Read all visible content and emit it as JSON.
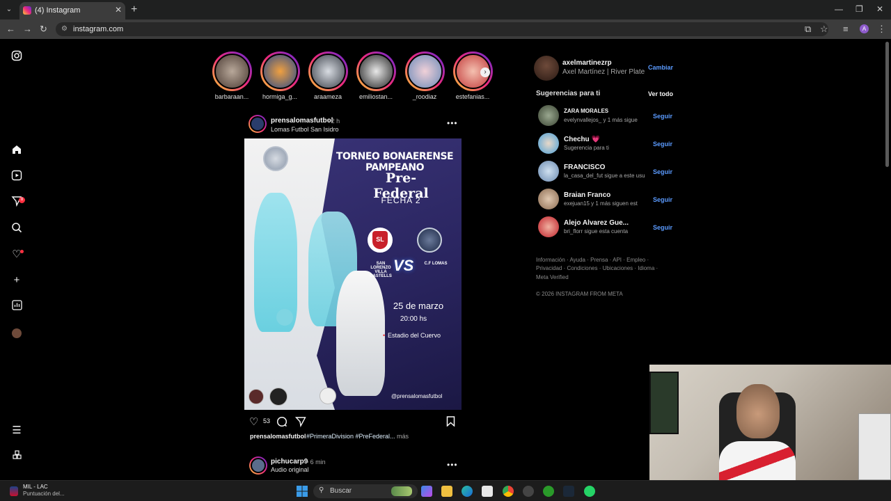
{
  "browser": {
    "tab_title": "(4) Instagram",
    "url": "instagram.com"
  },
  "stories": [
    {
      "name": "barbaraan..."
    },
    {
      "name": "hormiga_g..."
    },
    {
      "name": "araameza"
    },
    {
      "name": "emiliostan..."
    },
    {
      "name": "_roodiaz"
    },
    {
      "name": "estefanias..."
    }
  ],
  "nav_badge": "8",
  "post": {
    "user": "prensalomasfutbol",
    "time": "• 2 h",
    "location": "Lomas Futbol San Isidro",
    "likes": "53",
    "caption_user": "prensalomasfutbol",
    "caption_tags": "#PrimeraDivision #PreFederal...",
    "caption_more": "más",
    "image": {
      "title": "TORNEO BONAERENSE PAMPEANO",
      "subtitle": "Pre-Federal",
      "fecha": "FECHA 2",
      "home_abbr": "SL",
      "home_team": "SAN LORENZO VILLA CASTELLS",
      "vs": "VS",
      "away_team": "C.F LOMAS",
      "date": "25 de marzo",
      "hour": "20:00 hs",
      "stadium": "Estadio del Cuervo",
      "handle": "@prensalomasfutbol"
    }
  },
  "post2": {
    "user": "pichucarp9",
    "time": "• 6 min",
    "audio": "Audio original"
  },
  "profile": {
    "username": "axelmartinezrp",
    "fullname": "Axel Martínez | River Plate",
    "switch_label": "Cambiar"
  },
  "suggestions": {
    "header": "Sugerencias para ti",
    "see_all": "Ver todo",
    "follow_label": "Seguir",
    "items": [
      {
        "name": "ZARA MORALES",
        "sub": "evelynvallejos_ y 1 más sigue"
      },
      {
        "name": "Chechu 💗",
        "sub": "Sugerencia para ti"
      },
      {
        "name": "FRANCISCO",
        "sub": "la_casa_del_fut sigue a este usu"
      },
      {
        "name": "Braian Franco",
        "sub": "exejuan15 y 1 más siguen est"
      },
      {
        "name": "Alejo Alvarez Gue...",
        "sub": "bri_florr sigue esta cuenta"
      }
    ]
  },
  "footer": {
    "line1": "Información · Ayuda · Prensa · API · Empleo ·",
    "line2": "Privacidad · Condiciones · Ubicaciones · Idioma ·",
    "line3": "Meta Verified",
    "copyright": "© 2026 INSTAGRAM FROM META"
  },
  "taskbar": {
    "news_title": "MIL - LAC",
    "news_sub": "Puntuación del...",
    "search_placeholder": "Buscar"
  },
  "colors": {
    "accent_blue": "#5b9bff",
    "story_gradient": [
      "#f9ce34",
      "#ee2a7b",
      "#6228d7"
    ],
    "notification_red": "#ff3040"
  }
}
